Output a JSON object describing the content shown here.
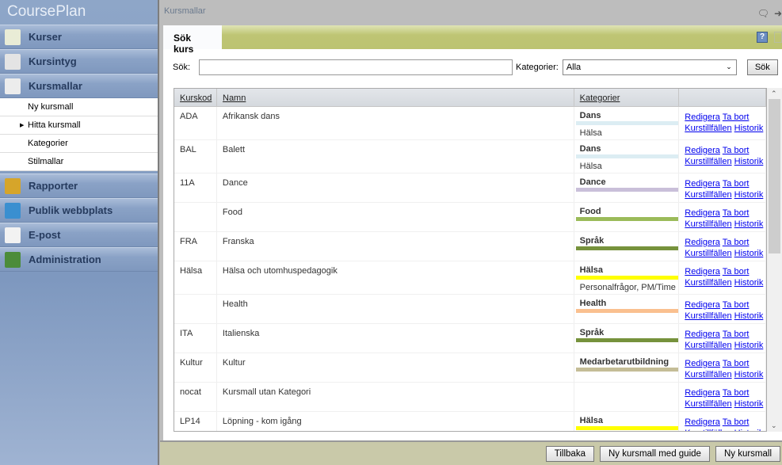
{
  "app": {
    "title": "CoursePlan"
  },
  "sidebar": {
    "top": [
      {
        "label": "Kurser",
        "icon": "document-list-icon",
        "color": "#e9ecd6"
      },
      {
        "label": "Kursintyg",
        "icon": "certificate-icon",
        "color": "#e4e4e4"
      },
      {
        "label": "Kursmallar",
        "icon": "template-icon",
        "color": "#ececec"
      }
    ],
    "sub": [
      {
        "label": "Ny kursmall"
      },
      {
        "label": "Hitta kursmall",
        "active": true
      },
      {
        "label": "Kategorier"
      },
      {
        "label": "Stilmallar"
      }
    ],
    "bottom": [
      {
        "label": "Rapporter",
        "icon": "chart-icon",
        "color": "#d6a52a"
      },
      {
        "label": "Publik webbplats",
        "icon": "globe-icon",
        "color": "#3a8fd0"
      },
      {
        "label": "E-post",
        "icon": "mail-icon",
        "color": "#f2f2f2"
      },
      {
        "label": "Administration",
        "icon": "admin-gear-icon",
        "color": "#4c8c3a"
      }
    ]
  },
  "header": {
    "breadcrumb": "Kursmallar"
  },
  "tab": {
    "label": "Sök kurs",
    "help": "?"
  },
  "search": {
    "label": "Sök:",
    "value": "",
    "category_label": "Kategorier:",
    "category_value": "Alla",
    "button": "Sök"
  },
  "table": {
    "headers": [
      "Kurskod",
      "Namn",
      "Kategorier",
      ""
    ],
    "link_labels": {
      "edit": "Redigera",
      "delete": "Ta bort",
      "instances": "Kurstillfällen",
      "history": "Historik"
    },
    "rows": [
      {
        "code": "ADA",
        "name": "Afrikansk dans",
        "cat": "Dans",
        "color": "#dcedf3",
        "cat2": "Hälsa"
      },
      {
        "code": "BAL",
        "name": "Balett",
        "cat": "Dans",
        "color": "#dcedf3",
        "cat2": "Hälsa"
      },
      {
        "code": "11A",
        "name": "Dance",
        "cat": "Dance",
        "color": "#c9bfd9",
        "cat2": ""
      },
      {
        "code": "",
        "name": "Food",
        "cat": "Food",
        "color": "#9bbb59",
        "cat2": ""
      },
      {
        "code": "FRA",
        "name": "Franska",
        "cat": "Språk",
        "color": "#76923c",
        "cat2": ""
      },
      {
        "code": "Hälsa",
        "name": "Hälsa och utomhuspedagogik",
        "cat": "Hälsa",
        "color": "#ffff00",
        "cat2": "Personalfrågor, PM/Time"
      },
      {
        "code": "",
        "name": "Health",
        "cat": "Health",
        "color": "#fac08f",
        "cat2": ""
      },
      {
        "code": "ITA",
        "name": "Italienska",
        "cat": "Språk",
        "color": "#76923c",
        "cat2": ""
      },
      {
        "code": "Kultur",
        "name": "Kultur",
        "cat": "Medarbetarutbildning",
        "color": "#c4bd97",
        "cat2": ""
      },
      {
        "code": "nocat",
        "name": "Kursmall utan Kategori",
        "cat": "",
        "color": "",
        "cat2": ""
      },
      {
        "code": "LP14",
        "name": "Löpning - kom igång",
        "cat": "Hälsa",
        "color": "#ffff00",
        "cat2": ""
      }
    ]
  },
  "footer": {
    "back": "Tillbaka",
    "guide": "Ny kursmall med guide",
    "new": "Ny kursmall"
  }
}
